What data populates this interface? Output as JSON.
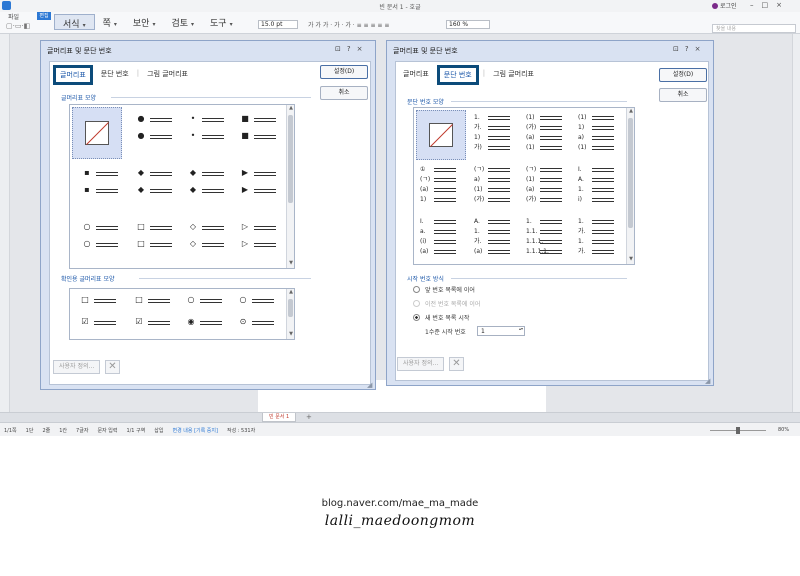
{
  "app": {
    "title": "빈 문서 1 - 호글",
    "login": "로그인",
    "quick_label": "파일",
    "quick_icons": "▢·▭·◧",
    "edit_label": "편집",
    "menu_tabs": [
      {
        "label": "서식",
        "active": true
      },
      {
        "label": "쪽"
      },
      {
        "label": "보안"
      },
      {
        "label": "검토"
      },
      {
        "label": "도구"
      }
    ],
    "font_size": "15.0  pt",
    "toolbar_misc": "가 가 가 · 가 · 가 · ≡ ≡ ≡ ≡ ≡",
    "zoom_field": "160  %",
    "search_placeholder": "찾을 내용",
    "window_controls": "–□×",
    "sheet_tab": "빈 문서 1",
    "sheet_add": "+",
    "status": [
      {
        "text": "1/1쪽"
      },
      {
        "text": "1단"
      },
      {
        "text": "2줄"
      },
      {
        "text": "1칸"
      },
      {
        "text": "7글자"
      },
      {
        "text": "문자 입력"
      },
      {
        "text": "1/1 구역"
      },
      {
        "text": "삽입"
      },
      {
        "text": "변경 내용 [기록 중지]",
        "hl": true
      },
      {
        "text": "작성 : 531자"
      }
    ],
    "status_zoom": "80%"
  },
  "dialog_left": {
    "title": "글머리표 및 문단 번호",
    "controls": "⊡?×",
    "tabs": [
      {
        "label": "글머리표",
        "active": true
      },
      {
        "label": "문단 번호"
      },
      {
        "label": "그림 글머리표"
      }
    ],
    "ok_label": "설정(D)",
    "cancel_label": "취소",
    "section1": "글머리표 모양",
    "section2": "확인용 글머리표 모양",
    "bullet_rows": [
      [
        "none",
        "●",
        "•",
        "■"
      ],
      [
        "▪",
        "◆",
        "◆",
        "▶"
      ],
      [
        "○",
        "□",
        "◇",
        "▷"
      ]
    ],
    "check_rows": [
      [
        "□",
        "□",
        "○",
        "○"
      ],
      [
        "☑",
        "☑",
        "◉",
        "⊙"
      ]
    ],
    "custom_label": "사용자 정의...",
    "x_label": "✕"
  },
  "dialog_right": {
    "title": "글머리표 및 문단 번호",
    "controls": "⊡?×",
    "tabs": [
      {
        "label": "글머리표"
      },
      {
        "label": "문단 번호",
        "active": true
      },
      {
        "label": "그림 글머리표"
      }
    ],
    "ok_label": "설정(D)",
    "cancel_label": "취소",
    "section1": "문단 번호 모양",
    "section2": "시작 번호 방식",
    "number_cells": [
      [
        null,
        [
          "1.",
          "가.",
          "1)",
          "가)"
        ],
        [
          "(1)",
          "(가)",
          "(a)",
          "(1)"
        ],
        [
          "(1)",
          "1)",
          "a)",
          "(1)"
        ]
      ],
      [
        [
          "①",
          "(ㄱ)",
          "(a)",
          "1)"
        ],
        [
          "(ㄱ)",
          "a)",
          "(1)",
          "(가)"
        ],
        [
          "(ㄱ)",
          "(1)",
          "(a)",
          "(가)"
        ],
        [
          "I.",
          "A.",
          "1.",
          "i)"
        ]
      ],
      [
        [
          "I.",
          "a.",
          "(i)",
          "(a)"
        ],
        [
          "A.",
          "1.",
          "가.",
          "(a)"
        ],
        [
          "1.",
          "1.1.",
          "1.1.1.",
          "1.1.1.1."
        ],
        [
          "1.",
          "가.",
          "1.",
          "가."
        ]
      ]
    ],
    "radios": [
      {
        "label": "앞 번호 목록에 이어",
        "on": false,
        "disabled": false
      },
      {
        "label": "이전 번호 목록에 이어",
        "on": false,
        "disabled": true
      },
      {
        "label": "새 번호 목록 시작",
        "on": true,
        "disabled": false
      }
    ],
    "level_label": "1수준 시작 번호",
    "level_value": "1",
    "custom_label": "사용자 정의...",
    "x_label": "✕"
  },
  "blog": {
    "url": "blog.naver.com/mae_ma_made",
    "signature": "lalli_maedoongmom"
  }
}
